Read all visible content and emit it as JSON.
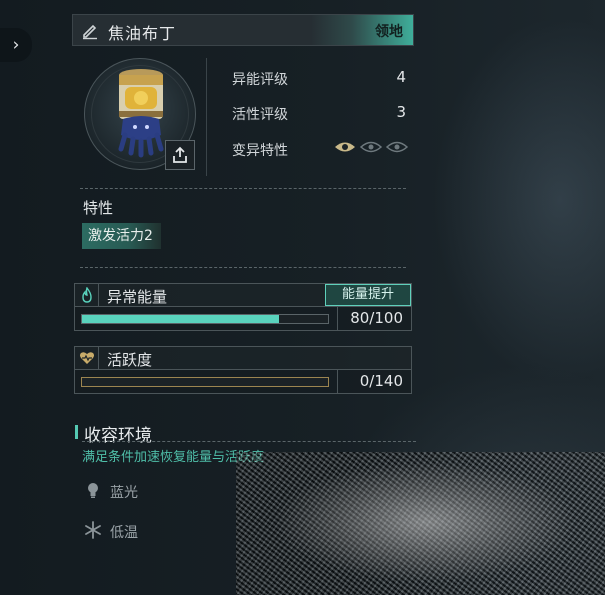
{
  "header": {
    "pet_name": "焦油布丁",
    "territory_label": "领地"
  },
  "stats": [
    {
      "label": "异能评级",
      "value": "4"
    },
    {
      "label": "活性评级",
      "value": "3"
    },
    {
      "label": "变异特性",
      "value": ""
    }
  ],
  "mutation_eyes": {
    "active": 1,
    "total": 3,
    "active_color": "#c9b98a",
    "inactive_color": "#7b868b"
  },
  "traits": {
    "title": "特性",
    "items": [
      "激发活力2"
    ]
  },
  "energy": {
    "title": "异常能量",
    "boost_label": "能量提升",
    "current": 80,
    "max": 100,
    "display": "80/100",
    "fill_fraction": 0.8,
    "bar_color": "#59d3bd"
  },
  "activity": {
    "title": "活跃度",
    "current": 0,
    "max": 140,
    "display": "0/140",
    "fill_fraction": 0,
    "bar_color": "#c9ac6a"
  },
  "environment": {
    "title": "收容环境",
    "subtitle": "满足条件加速恢复能量与活跃度",
    "items": [
      {
        "label": "蓝光",
        "icon": "lightbulb-icon"
      },
      {
        "label": "低温",
        "icon": "snowflake-icon"
      }
    ]
  },
  "colors": {
    "accent": "#3fae9a",
    "gold": "#c9ac6a"
  }
}
